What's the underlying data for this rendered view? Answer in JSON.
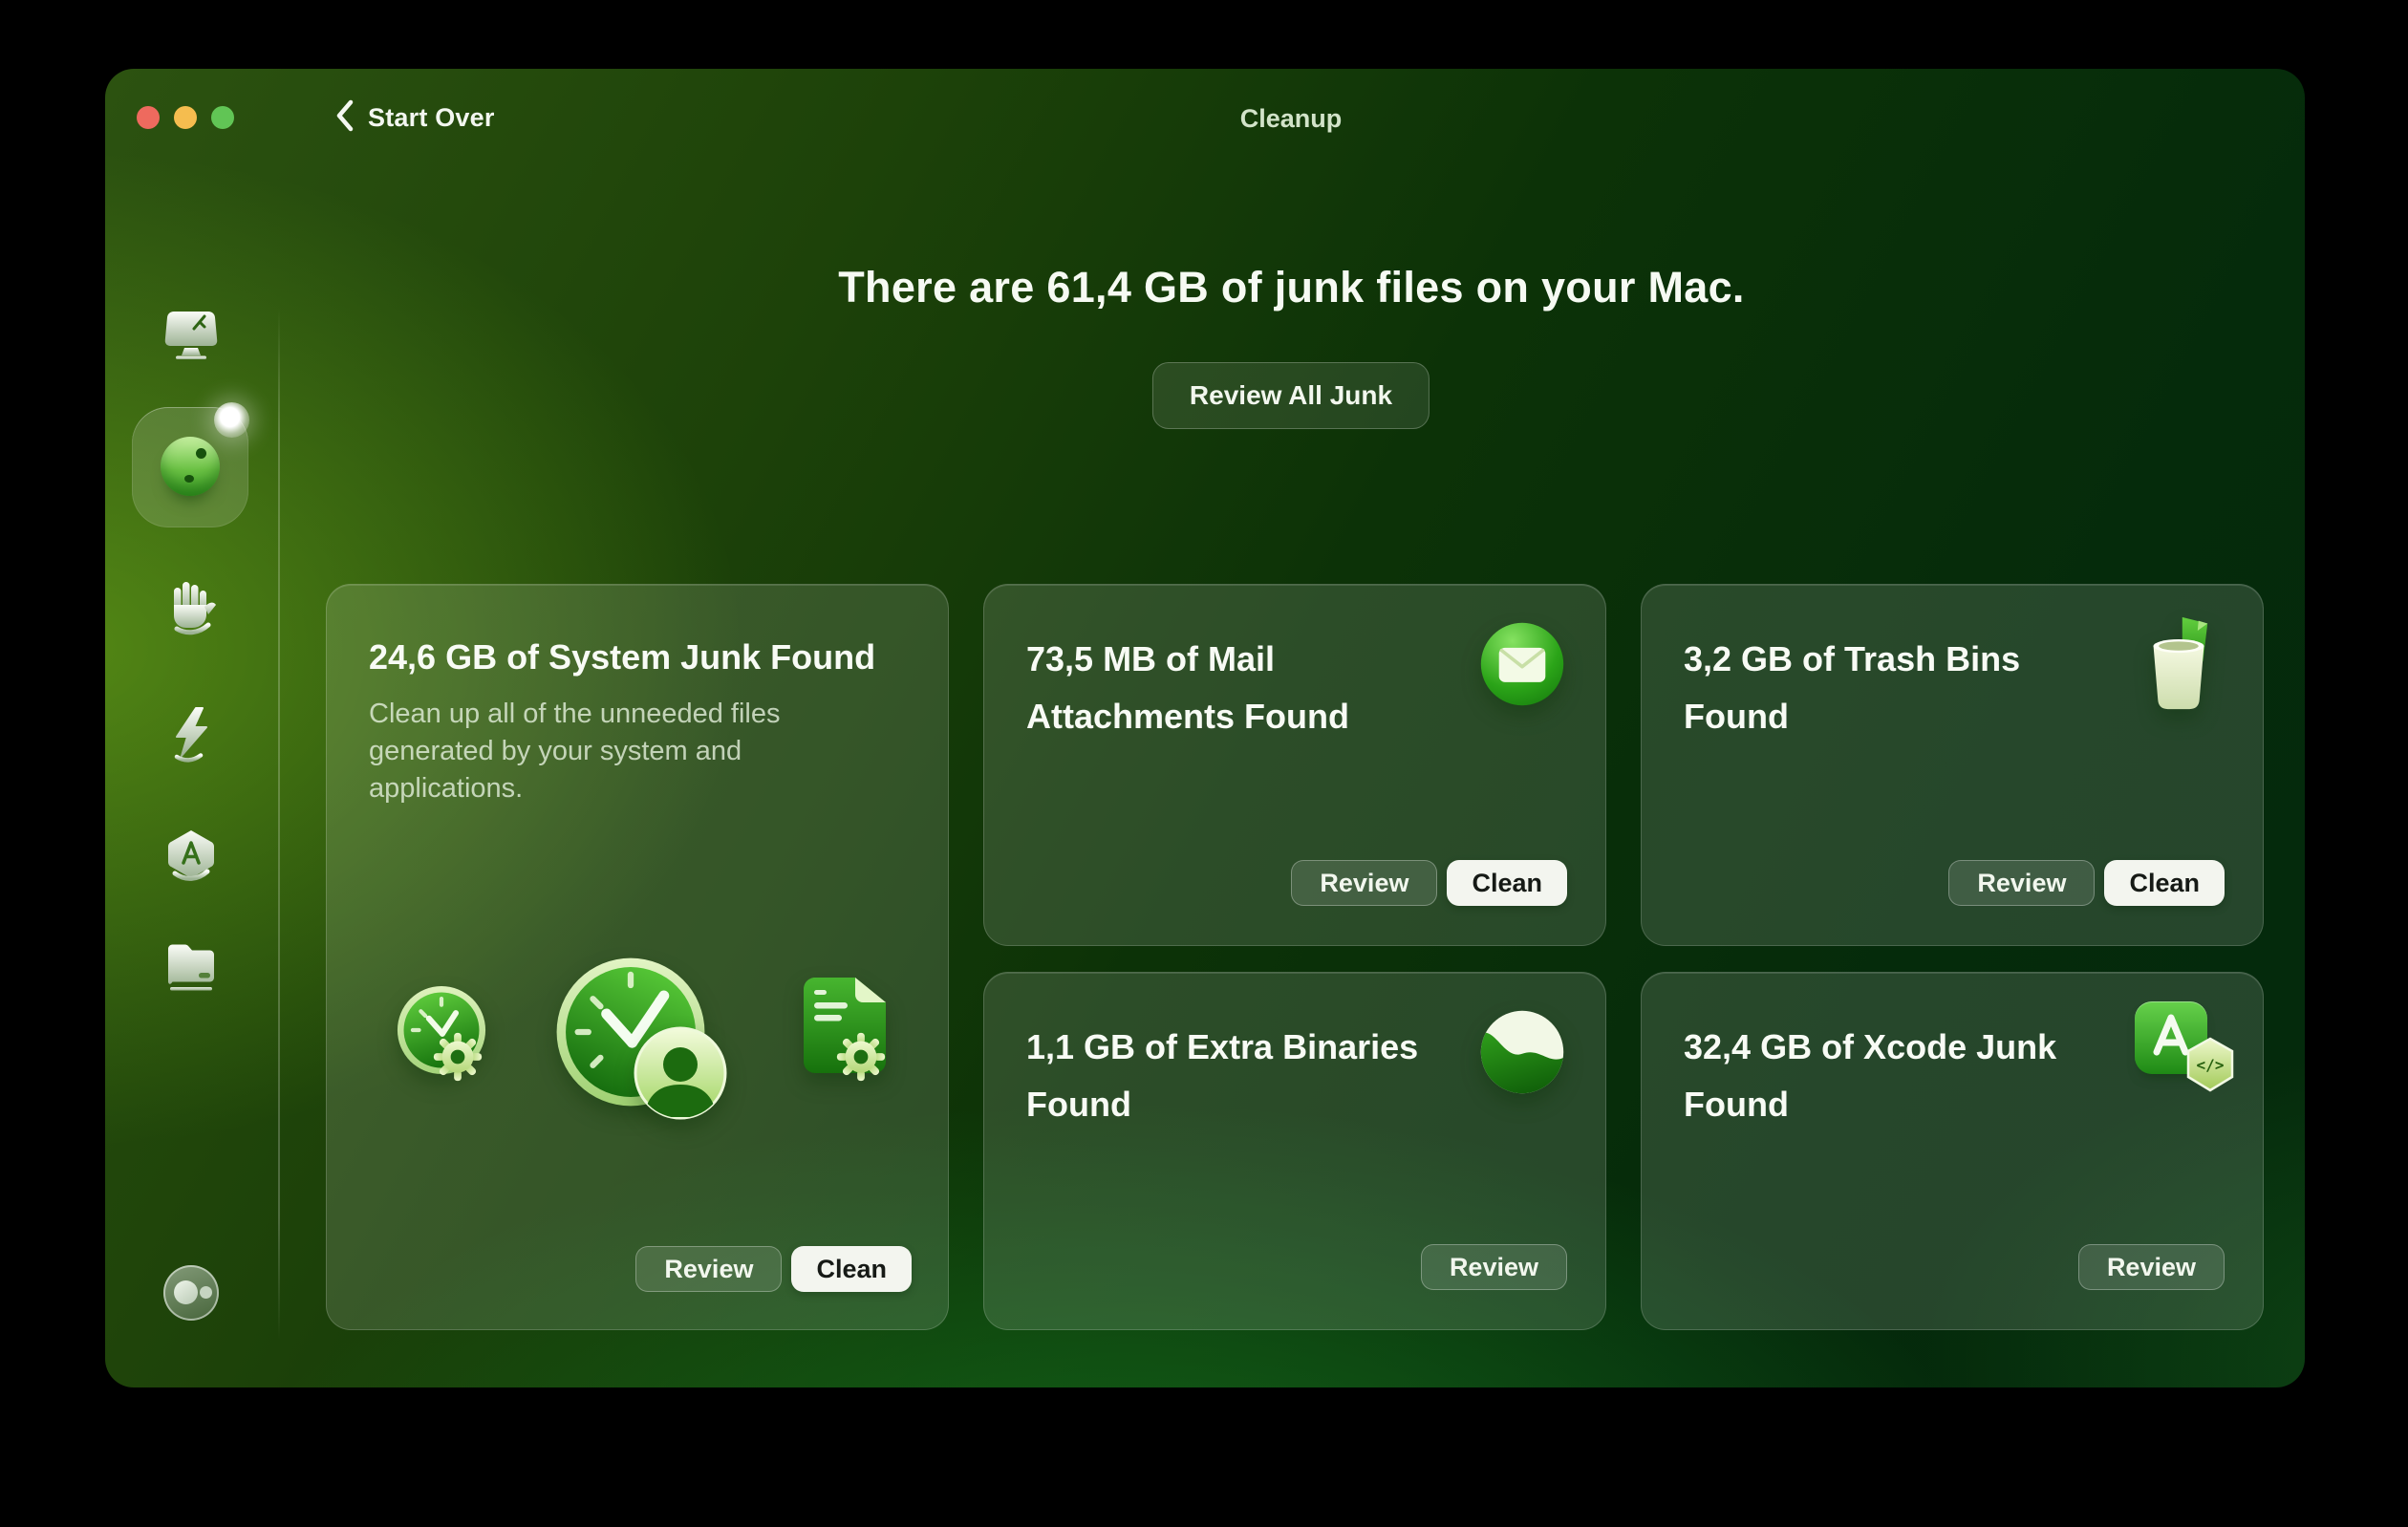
{
  "titlebar": {
    "back_label": "Start Over",
    "title": "Cleanup",
    "traffic_lights": [
      "close",
      "minimize",
      "zoom"
    ]
  },
  "hero": {
    "heading": "There are 61,4 GB of junk files on your Mac.",
    "review_all_label": "Review All Junk"
  },
  "sidebar": {
    "items": [
      {
        "icon": "monitor-sparkle-icon",
        "selected": false
      },
      {
        "icon": "cleanup-orb-icon",
        "selected": true,
        "notification_dot": "glow-dot"
      },
      {
        "icon": "hand-icon",
        "selected": false
      },
      {
        "icon": "lightning-icon",
        "selected": false
      },
      {
        "icon": "app-store-hexagon-icon",
        "selected": false
      },
      {
        "icon": "folder-icon",
        "selected": false
      }
    ],
    "footer_icon": "assistant-avatar-icon"
  },
  "cards": [
    {
      "title": "24,6 GB of System Junk Found",
      "description": "Clean up all of the unneeded files generated by your system and applications.",
      "icons": [
        "clock-gear-icon",
        "clock-user-icon",
        "document-gear-icon"
      ],
      "review_label": "Review",
      "clean_label": "Clean"
    },
    {
      "title": "73,5 MB of Mail Attachments Found",
      "icon": "mail-envelope-icon",
      "review_label": "Review",
      "clean_label": "Clean"
    },
    {
      "title": "3,2 GB of Trash Bins Found",
      "icon": "trash-bin-icon",
      "review_label": "Review",
      "clean_label": "Clean"
    },
    {
      "title": "1,1 GB of Extra Binaries Found",
      "icon": "binaries-wave-icon",
      "review_label": "Review"
    },
    {
      "title": "32,4 GB of Xcode Junk Found",
      "icon": "xcode-icon",
      "review_label": "Review"
    }
  ],
  "colors": {
    "traffic_red": "#ee6a5e",
    "traffic_yellow": "#f5bd4f",
    "traffic_green": "#61c555",
    "clean_button_bg": "#f3f5ef",
    "accent_green": "#2f9e1d"
  }
}
